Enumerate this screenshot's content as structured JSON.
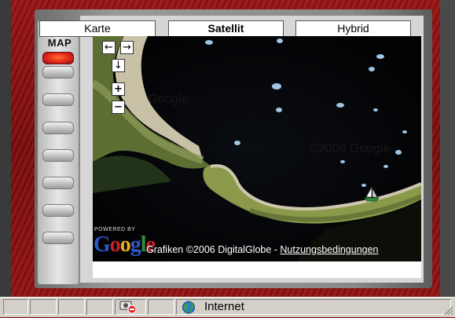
{
  "map_types": [
    {
      "label": "Karte",
      "active": false
    },
    {
      "label": "Satellit",
      "active": true
    },
    {
      "label": "Hybrid",
      "active": false
    }
  ],
  "side_panel": {
    "title": "MAP",
    "buttons": [
      "map-active",
      "btn-2",
      "btn-3",
      "btn-4",
      "btn-5",
      "btn-6",
      "btn-7",
      "btn-8"
    ]
  },
  "map": {
    "nav": {
      "left": "←",
      "right": "→",
      "down": "↓",
      "zoom_in": "+",
      "zoom_out": "−"
    },
    "powered_by": "POWERED BY",
    "google_logo": "Google",
    "copyright": "Grafiken ©2006 DigitalGlobe - ",
    "terms_link": "Nutzungsbedingungen",
    "marker_icon": "sailboat-icon"
  },
  "statusbar": {
    "zone_label": "Internet",
    "zone_icon": "globe-icon",
    "privacy_icon": "privacy-blocked-icon"
  },
  "colors": {
    "background_red": "#8a1010",
    "sea": "#040404",
    "land": "#8a9a4a",
    "reef": "#cfc6ae"
  }
}
